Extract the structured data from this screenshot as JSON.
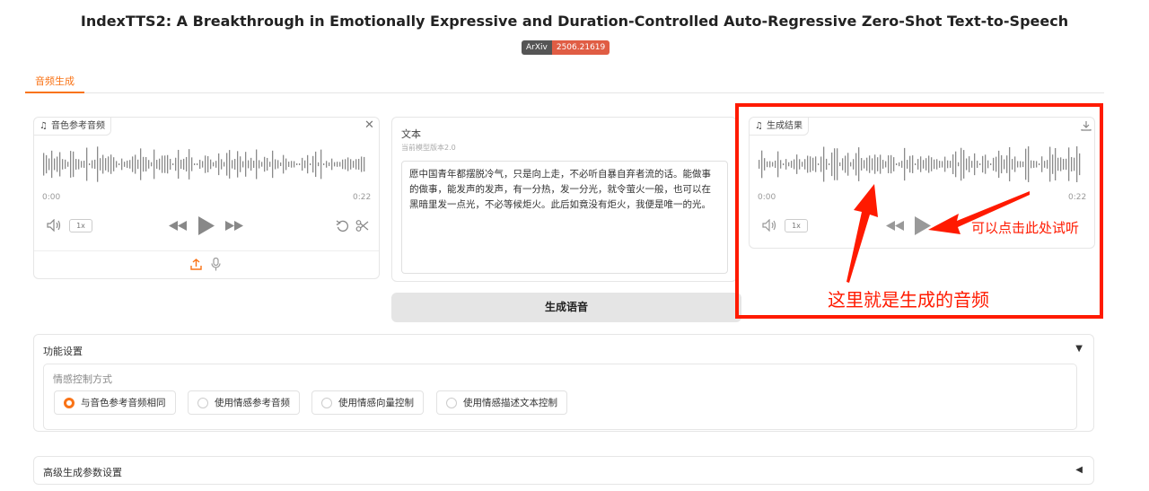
{
  "header": {
    "title": "IndexTTS2: A Breakthrough in Emotionally Expressive and Duration-Controlled Auto-Regressive Zero-Shot Text-to-Speech",
    "badge_left": "ArXiv",
    "badge_right": "2506.21619"
  },
  "tabs": [
    {
      "label": "音频生成",
      "active": true
    }
  ],
  "reference_audio": {
    "label": "音色参考音频",
    "time_start": "0:00",
    "time_end": "0:22",
    "speed": "1x",
    "icons": [
      "music-icon",
      "close-icon",
      "volume-icon",
      "rewind-icon",
      "play-icon",
      "forward-icon",
      "undo-icon",
      "scissors-icon",
      "upload-icon",
      "microphone-icon"
    ]
  },
  "text_input": {
    "label": "文本",
    "info": "当前模型版本2.0",
    "value": "愿中国青年都摆脱冷气，只是向上走，不必听自暴自弃者流的话。能做事的做事，能发声的发声，有一分热，发一分光，就令萤火一般，也可以在黑暗里发一点光，不必等候炬火。此后如竟没有炬火，我便是唯一的光。"
  },
  "generate_button": {
    "label": "生成语音"
  },
  "result_audio": {
    "label": "生成结果",
    "time_start": "0:00",
    "time_end": "0:22",
    "speed": "1x"
  },
  "annotations": {
    "play_hint": "可以点击此处试听",
    "audio_hint": "这里就是生成的音频",
    "color": "#ff1a00"
  },
  "settings": {
    "title": "功能设置",
    "emotion_label": "情感控制方式",
    "options": [
      "与音色参考音频相同",
      "使用情感参考音频",
      "使用情感向量控制",
      "使用情感描述文本控制"
    ],
    "selected_index": 0
  },
  "advanced": {
    "title": "高级生成参数设置"
  },
  "colors": {
    "accent": "#f97316",
    "annotation": "#ff1a00"
  }
}
